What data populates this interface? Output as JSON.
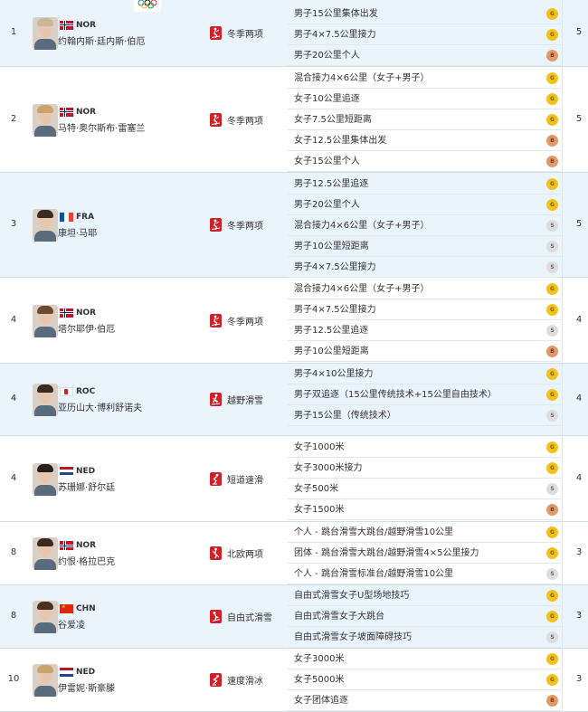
{
  "colors": {
    "blue_row": "#eaf4fd",
    "sport_icon": "#d0202a",
    "gold": "#f3c11e",
    "silver": "#dddddd",
    "bronze": "#df9a6a"
  },
  "rows": [
    {
      "rank": "1",
      "country": "NOR",
      "name": "约翰内斯·廷内斯·伯厄",
      "sport": "冬季两项",
      "sport_icon": "biathlon-icon",
      "total": "5",
      "events": [
        {
          "name": "男子15公里集体出发",
          "medal": "G"
        },
        {
          "name": "男子4×7.5公里接力",
          "medal": "G"
        },
        {
          "name": "男子20公里个人",
          "medal": "B"
        }
      ]
    },
    {
      "rank": "2",
      "country": "NOR",
      "name": "马特·奥尔斯布·雷塞兰",
      "sport": "冬季两项",
      "sport_icon": "biathlon-icon",
      "total": "5",
      "events": [
        {
          "name": "混合接力4×6公里（女子+男子）",
          "medal": "G"
        },
        {
          "name": "女子10公里追逐",
          "medal": "G"
        },
        {
          "name": "女子7.5公里短距离",
          "medal": "G"
        },
        {
          "name": "女子12.5公里集体出发",
          "medal": "B"
        },
        {
          "name": "女子15公里个人",
          "medal": "B"
        }
      ]
    },
    {
      "rank": "3",
      "country": "FRA",
      "name": "康坦·马耶",
      "sport": "冬季两项",
      "sport_icon": "biathlon-icon",
      "total": "5",
      "events": [
        {
          "name": "男子12.5公里追逐",
          "medal": "G"
        },
        {
          "name": "男子20公里个人",
          "medal": "G"
        },
        {
          "name": "混合接力4×6公里（女子+男子）",
          "medal": "S"
        },
        {
          "name": "男子10公里短距离",
          "medal": "S"
        },
        {
          "name": "男子4×7.5公里接力",
          "medal": "S"
        }
      ]
    },
    {
      "rank": "4",
      "country": "NOR",
      "name": "塔尔耶伊·伯厄",
      "sport": "冬季两项",
      "sport_icon": "biathlon-icon",
      "total": "4",
      "events": [
        {
          "name": "混合接力4×6公里（女子+男子）",
          "medal": "G"
        },
        {
          "name": "男子4×7.5公里接力",
          "medal": "G"
        },
        {
          "name": "男子12.5公里追逐",
          "medal": "S"
        },
        {
          "name": "男子10公里短距离",
          "medal": "B"
        }
      ]
    },
    {
      "rank": "4",
      "country": "ROC",
      "name": "亚历山大·博利舒诺夫",
      "sport": "越野滑雪",
      "sport_icon": "cross-country-skiing-icon",
      "total": "4",
      "events": [
        {
          "name": "男子4×10公里接力",
          "medal": "G"
        },
        {
          "name": "男子双追逐（15公里传统技术+15公里自由技术）",
          "medal": "G"
        },
        {
          "name": "男子15公里（传统技术）",
          "medal": "S"
        }
      ]
    },
    {
      "rank": "4",
      "country": "NED",
      "name": "苏珊娜·舒尔廷",
      "sport": "短道速滑",
      "sport_icon": "short-track-icon",
      "total": "4",
      "events": [
        {
          "name": "女子1000米",
          "medal": "G"
        },
        {
          "name": "女子3000米接力",
          "medal": "G"
        },
        {
          "name": "女子500米",
          "medal": "S"
        },
        {
          "name": "女子1500米",
          "medal": "B"
        }
      ]
    },
    {
      "rank": "8",
      "country": "NOR",
      "name": "约恨·格拉巴克",
      "sport": "北欧两项",
      "sport_icon": "nordic-combined-icon",
      "total": "3",
      "events": [
        {
          "name": "个人 - 跳台滑雪大跳台/越野滑雪10公里",
          "medal": "G"
        },
        {
          "name": "团体 - 跳台滑雪大跳台/越野滑雪4×5公里接力",
          "medal": "G"
        },
        {
          "name": "个人 - 跳台滑雪标准台/越野滑雪10公里",
          "medal": "S"
        }
      ]
    },
    {
      "rank": "8",
      "country": "CHN",
      "name": "谷爱凌",
      "sport": "自由式滑雪",
      "sport_icon": "freestyle-skiing-icon",
      "total": "3",
      "events": [
        {
          "name": "自由式滑雪女子U型场地技巧",
          "medal": "G"
        },
        {
          "name": "自由式滑雪女子大跳台",
          "medal": "G"
        },
        {
          "name": "自由式滑雪女子坡面障碍技巧",
          "medal": "S"
        }
      ]
    },
    {
      "rank": "10",
      "country": "NED",
      "name": "伊雷妮·斯豪滕",
      "sport": "速度滑冰",
      "sport_icon": "speed-skating-icon",
      "total": "3",
      "events": [
        {
          "name": "女子3000米",
          "medal": "G"
        },
        {
          "name": "女子5000米",
          "medal": "G"
        },
        {
          "name": "女子团体追逐",
          "medal": "B"
        }
      ]
    }
  ]
}
